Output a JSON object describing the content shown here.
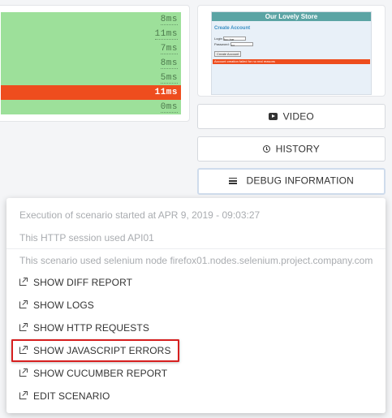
{
  "timings": {
    "rows": [
      {
        "label": "8ms",
        "status": "ok"
      },
      {
        "label": "11ms",
        "status": "ok"
      },
      {
        "label": "7ms",
        "status": "ok"
      },
      {
        "label": "8ms",
        "status": "ok"
      },
      {
        "label": "5ms",
        "status": "ok"
      },
      {
        "label": "11ms",
        "status": "error"
      },
      {
        "label": "0ms",
        "status": "ok"
      }
    ],
    "ok_color": "#9de09a",
    "error_color": "#ee4d1e"
  },
  "preview": {
    "title": "Our Lovely Store",
    "heading": "Create Account",
    "login_label": "Login",
    "login_value": "foo.bar",
    "password_label": "Password:",
    "password_value": "•••",
    "button_label": "Create Account",
    "error_text": "Account creation failed for no real reasons"
  },
  "buttons": {
    "video": {
      "label": "VIDEO",
      "icon": "youtube-play-icon"
    },
    "history": {
      "label": "HISTORY",
      "icon": "history-clock-icon"
    },
    "debug": {
      "label": "DEBUG INFORMATION",
      "icon": "menu-icon"
    }
  },
  "debug_menu": {
    "info": [
      "Execution of scenario started at APR 9, 2019 - 09:03:27",
      "This HTTP session used API01",
      "This scenario used selenium node firefox01.nodes.selenium.project.company.com"
    ],
    "items": [
      "SHOW DIFF REPORT",
      "SHOW LOGS",
      "SHOW HTTP REQUESTS",
      "SHOW JAVASCRIPT ERRORS",
      "SHOW CUCUMBER REPORT",
      "EDIT SCENARIO"
    ],
    "item_icon": "external-link-icon",
    "highlighted_item": "SHOW JAVASCRIPT ERRORS",
    "highlight_color": "#d71f1f"
  }
}
